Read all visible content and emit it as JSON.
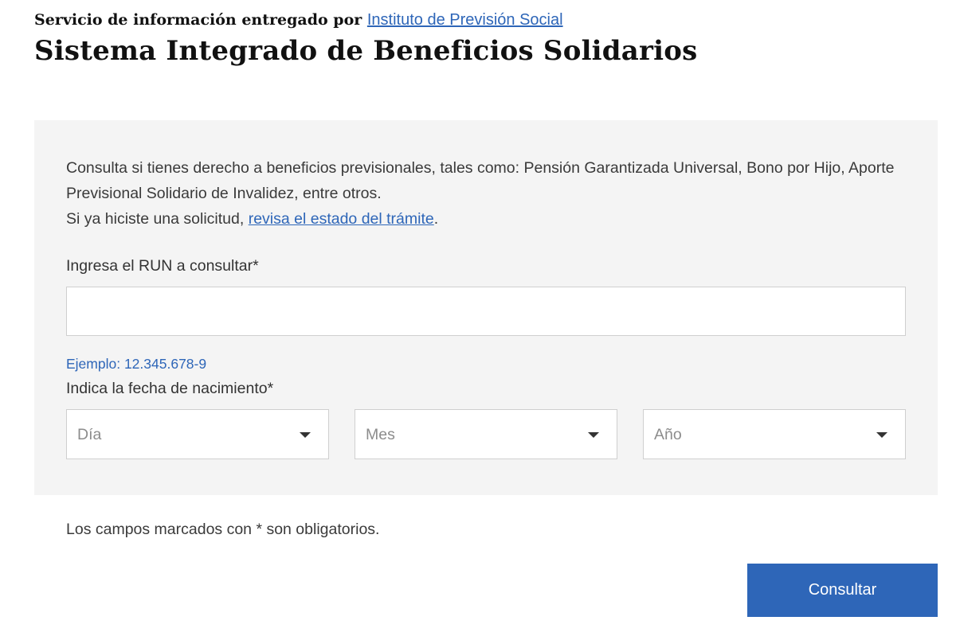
{
  "header": {
    "provider_prefix": "Servicio de información entregado por",
    "provider_link": "Instituto de Previsión Social",
    "title": "Sistema Integrado de Beneficios Solidarios"
  },
  "form": {
    "intro_line1": "Consulta si tienes derecho a beneficios previsionales, tales como: Pensión Garantizada Universal, Bono por Hijo, Aporte Previsional Solidario de Invalidez, entre otros.",
    "intro_line2_prefix": "Si ya hiciste una solicitud,",
    "intro_line2_link": "revisa el estado del trámite",
    "intro_line2_suffix": ".",
    "run_label": "Ingresa el RUN a consultar*",
    "run_value": "",
    "run_hint": "Ejemplo: 12.345.678-9",
    "birthdate_label": "Indica la fecha de nacimiento*",
    "day_placeholder": "Día",
    "month_placeholder": "Mes",
    "year_placeholder": "Año"
  },
  "footer": {
    "required_note": "Los campos marcados con * son obligatorios.",
    "submit_label": "Consultar"
  },
  "colors": {
    "accent": "#2e66b8",
    "panel_bg": "#f4f4f4"
  }
}
